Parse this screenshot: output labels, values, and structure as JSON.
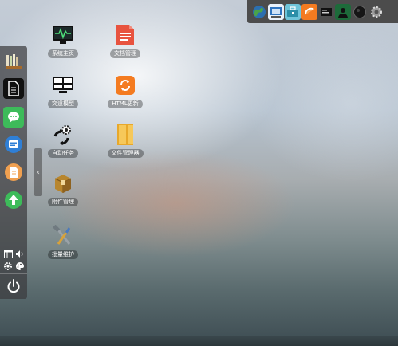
{
  "taskbar": {
    "icons": [
      "globe-icon",
      "windows-ie-icon",
      "briefcase-icon",
      "orange-slice-icon",
      "dark-panel-icon",
      "user-icon",
      "dark-orb-icon",
      "gear-icon"
    ]
  },
  "desktop": {
    "icons": [
      {
        "label": "系统主页",
        "icon": "pulse-monitor-icon"
      },
      {
        "label": "文档管理",
        "icon": "document-icon"
      },
      {
        "label": "突道模型",
        "icon": "grid-monitor-icon"
      },
      {
        "label": "HTML更新",
        "icon": "refresh-icon"
      },
      {
        "label": "自动任务",
        "icon": "gear-refresh-icon"
      },
      {
        "label": "文件管理器",
        "icon": "folder-icon"
      },
      {
        "label": "附件管理",
        "icon": "package-icon"
      },
      {
        "label": "批量维护",
        "icon": "tools-icon"
      }
    ]
  },
  "dock": {
    "apps": [
      "library-icon",
      "notes-icon",
      "chat-icon",
      "list-card-icon",
      "document-orange-icon",
      "upload-arrow-icon"
    ],
    "controls": [
      "window-icon",
      "volume-icon",
      "gear-icon",
      "palette-icon"
    ],
    "power": "power-icon"
  },
  "colors": {
    "accent": "#f47b20",
    "dock": "#3c3c3e",
    "taskbar": "#4c4c4c"
  }
}
